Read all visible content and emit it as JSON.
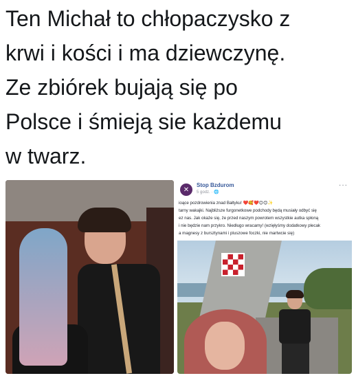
{
  "tweet": {
    "lines": [
      "Ten Michał to chłopaczysko z",
      "krwi i kości i ma dziewczynę.",
      "Ze zbiórek bujają się po",
      "Polsce i śmieją sie każdemu",
      "w twarz."
    ]
  },
  "facebook_post": {
    "page_name": "Stop Bzdurom",
    "time": "5 godz. · 🌐",
    "more_icon": "···",
    "text_lines": [
      "ioące pozdrowienia znad Bałtyku! ❤️🥰❤️😊😊✨",
      "tarny wakajki. Najbliższe furgonetkowe podchody będą musiały odbyć się",
      "ez nas. Jak okaże się, że przed naszym powrotem wszystkie autka spłoną",
      "i nie będzie nam przykro. Niedługo wracamy! (wzięłyśmy dodatkowy plecak",
      "a magnesy z bursztynami i pluszowe foczki, nie martwcie się)"
    ]
  }
}
